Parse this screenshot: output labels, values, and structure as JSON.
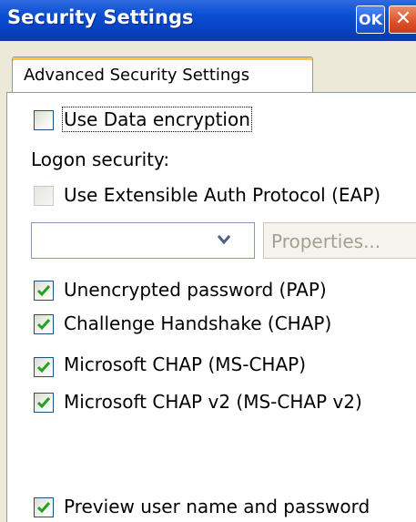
{
  "window": {
    "title": "Security Settings",
    "ok_label": "OK",
    "close_glyph": "✕"
  },
  "tab": {
    "label": "Advanced Security Settings"
  },
  "data_encryption": {
    "label": "Use Data encryption",
    "checked": false
  },
  "logon_security": {
    "label": "Logon security:"
  },
  "eap": {
    "label": "Use Extensible Auth Protocol (EAP)",
    "checked": false,
    "disabled": true
  },
  "eap_select": {
    "value": ""
  },
  "properties_button": {
    "label": "Properties..."
  },
  "pap": {
    "label": "Unencrypted password (PAP)",
    "checked": true
  },
  "chap": {
    "label": "Challenge Handshake  (CHAP)",
    "checked": true
  },
  "ms_chap": {
    "label": "Microsoft CHAP (MS-CHAP)",
    "checked": true
  },
  "ms_chap_v2": {
    "label": "Microsoft CHAP v2 (MS-CHAP v2)",
    "checked": true
  },
  "preview": {
    "label": "Preview user name and password",
    "checked": true
  },
  "colors": {
    "titlebar": "#0b4fd4",
    "check": "#21a121",
    "close": "#e0532c"
  }
}
